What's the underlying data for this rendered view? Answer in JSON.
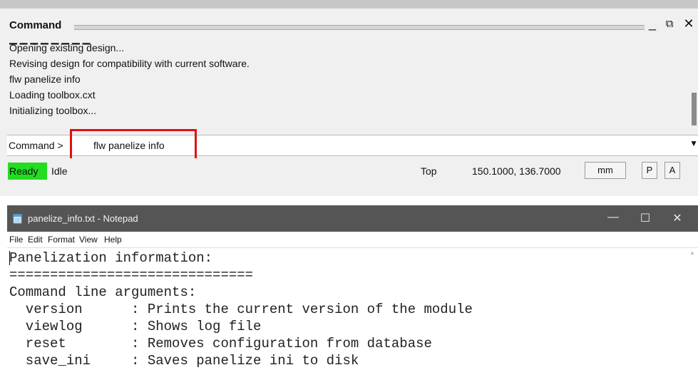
{
  "command_panel": {
    "title": "Command",
    "controls": {
      "minimize": "_",
      "restore": "⧉",
      "close": "✕"
    },
    "history": [
      "Opening existing design...",
      "Revising design for compatibility with current software.",
      "flw panelize info",
      "Loading toolbox.cxt",
      "Initializing toolbox..."
    ],
    "prompt": "Command >",
    "input_value": "flw panelize info",
    "dropdown_glyph": "▼"
  },
  "status_bar": {
    "state": "Ready",
    "mode": "Idle",
    "view": "Top",
    "coordinates": "150.1000, 136.7000",
    "units": "mm",
    "p_button": "P",
    "a_button": "A",
    "colors": {
      "ready": "#22dd22"
    }
  },
  "notepad": {
    "title": "panelize_info.txt - Notepad",
    "controls": {
      "minimize": "—",
      "maximize": "☐",
      "close": "✕"
    },
    "menu": [
      "File",
      "Edit",
      "Format",
      "View",
      "Help"
    ],
    "lines": [
      "Panelization information:",
      "==============================",
      "Command line arguments:",
      "  version      : Prints the current version of the module",
      "  viewlog      : Shows log file",
      "  reset        : Removes configuration from database",
      "  save_ini     : Saves panelize ini to disk"
    ]
  }
}
